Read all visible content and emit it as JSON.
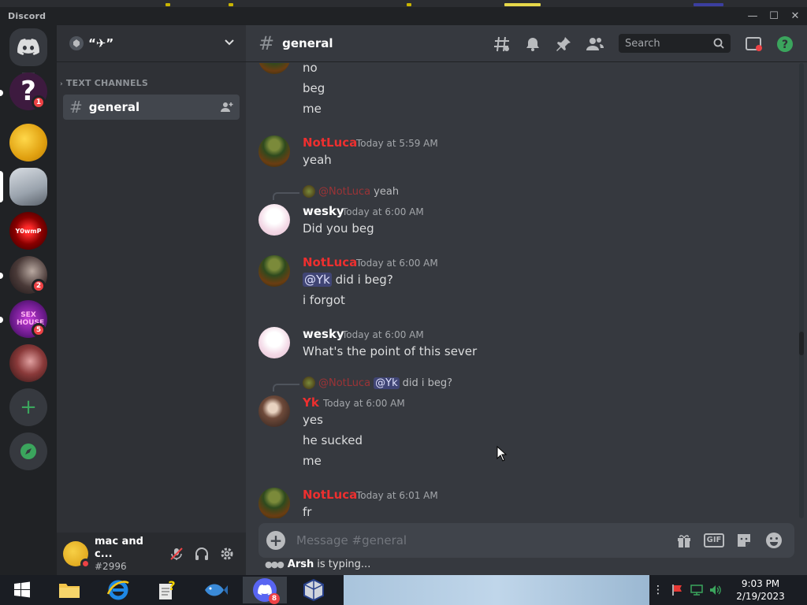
{
  "window": {
    "title": "Discord",
    "minimize": "—",
    "maximize": "☐",
    "close": "✕"
  },
  "servers": {
    "items": [
      {
        "name": "server-p",
        "badge": "1"
      },
      {
        "name": "server-yellow",
        "badge": ""
      },
      {
        "name": "server-hoodie",
        "badge": ""
      },
      {
        "name": "server-red",
        "badge": ""
      },
      {
        "name": "server-dark",
        "badge": "2"
      },
      {
        "name": "server-purple",
        "badge": "5"
      },
      {
        "name": "server-portrait",
        "badge": ""
      }
    ],
    "server_p_letter": "?",
    "purple_server_text": "SEX HOUSE",
    "red_server_text": "Y0wmP",
    "add_symbol": "+"
  },
  "guild": {
    "name": "“✈”",
    "category": "TEXT CHANNELS",
    "channels": [
      {
        "name": "general"
      }
    ]
  },
  "user": {
    "name": "mac and c...",
    "tag": "#2996"
  },
  "channel": {
    "hash": "#",
    "name": "general",
    "search_placeholder": "Search"
  },
  "messages": [
    {
      "lines": [
        "no",
        "beg",
        "me"
      ]
    },
    {
      "author": "NotLuca",
      "time": "Today at 5:59 AM",
      "lines": [
        "yeah"
      ]
    },
    {
      "reply": {
        "author": "@NotLuca",
        "text": "yeah"
      },
      "author": "wesky",
      "time": "Today at 6:00 AM",
      "lines": [
        "Did you beg"
      ]
    },
    {
      "author": "NotLuca",
      "time": "Today at 6:00 AM",
      "mention": "@Yk",
      "lines": [
        "did i beg?",
        "i forgot"
      ]
    },
    {
      "author": "wesky",
      "time": "Today at 6:00 AM",
      "lines": [
        "What's the point of this sever"
      ]
    },
    {
      "reply": {
        "author": "@NotLuca",
        "mention": "@Yk",
        "text": "did i beg?"
      },
      "author": "Yk",
      "time": "Today at 6:00 AM",
      "lines": [
        "yes",
        "he sucked",
        "me"
      ]
    },
    {
      "author": "NotLuca",
      "time": "Today at 6:01 AM",
      "lines": [
        "fr"
      ]
    }
  ],
  "composer": {
    "placeholder": "Message #general",
    "gif_label": "GIF"
  },
  "typing": {
    "user": "Arsh",
    "suffix": "is typing..."
  },
  "taskbar": {
    "discord_badge": "8",
    "time": "9:03 PM",
    "date": "2/19/2023"
  },
  "colors": {
    "username_red": "#ed2f2f",
    "online_green": "#3ba55d",
    "badge_red": "#ed4245",
    "background": "#36393f"
  }
}
